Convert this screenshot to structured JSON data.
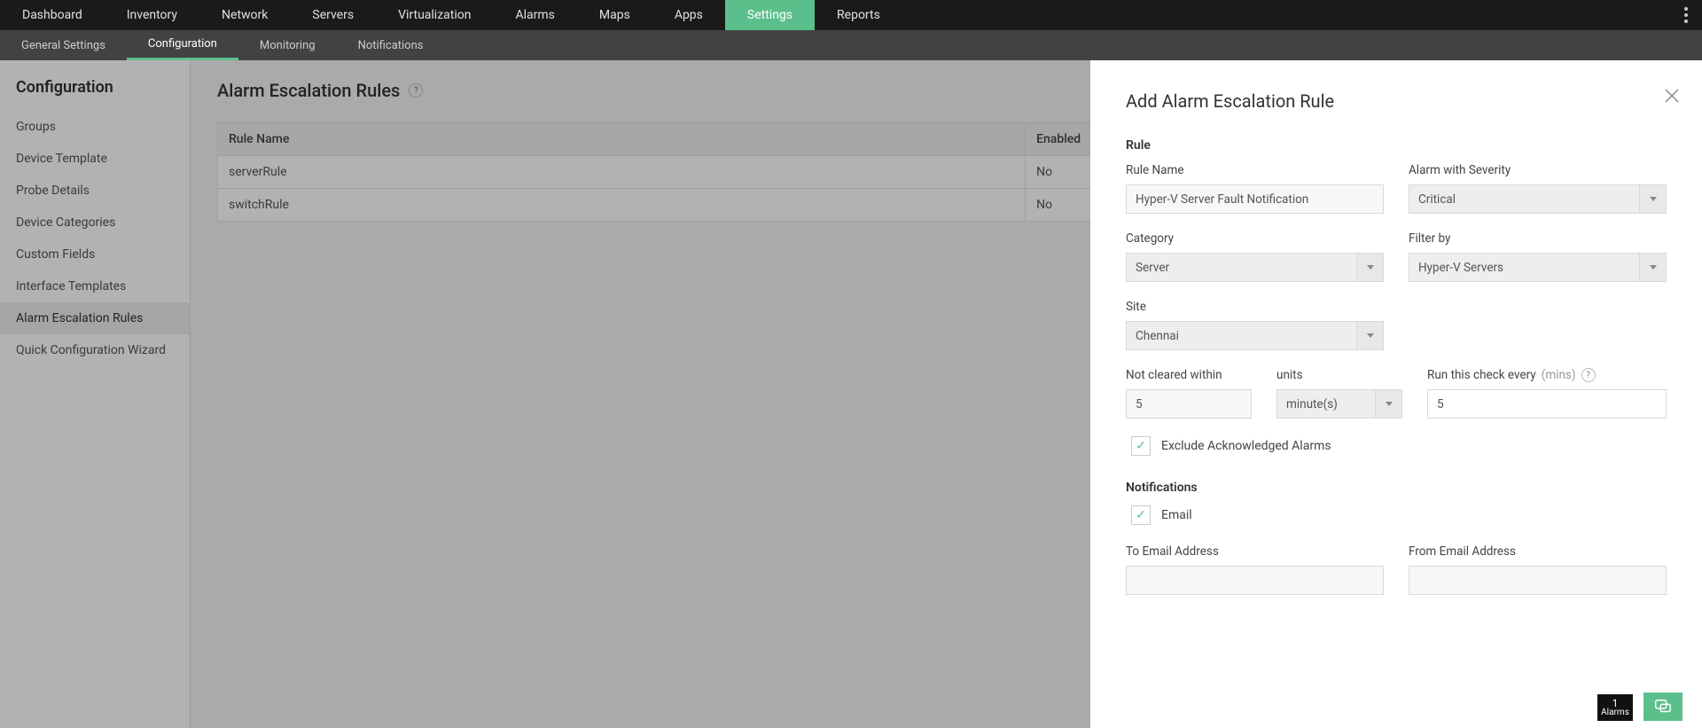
{
  "topnav": {
    "items": [
      "Dashboard",
      "Inventory",
      "Network",
      "Servers",
      "Virtualization",
      "Alarms",
      "Maps",
      "Apps",
      "Settings",
      "Reports"
    ],
    "active": "Settings"
  },
  "subnav": {
    "items": [
      "General Settings",
      "Configuration",
      "Monitoring",
      "Notifications"
    ],
    "active": "Configuration"
  },
  "sidebar": {
    "title": "Configuration",
    "items": [
      "Groups",
      "Device Template",
      "Probe Details",
      "Device Categories",
      "Custom Fields",
      "Interface Templates",
      "Alarm Escalation Rules",
      "Quick Configuration Wizard"
    ],
    "active": "Alarm Escalation Rules"
  },
  "page": {
    "title": "Alarm Escalation Rules",
    "help": "?",
    "columns": [
      "Rule Name",
      "Enabled"
    ],
    "rows": [
      {
        "name": "serverRule",
        "enabled": "No"
      },
      {
        "name": "switchRule",
        "enabled": "No"
      }
    ]
  },
  "panel": {
    "title": "Add Alarm Escalation Rule",
    "section_rule": "Rule",
    "rule_name_label": "Rule Name",
    "rule_name_value": "Hyper-V Server Fault Notification",
    "severity_label": "Alarm with Severity",
    "severity_value": "Critical",
    "category_label": "Category",
    "category_value": "Server",
    "filter_label": "Filter by",
    "filter_value": "Hyper-V Servers",
    "site_label": "Site",
    "site_value": "Chennai",
    "notcleared_label": "Not cleared within",
    "notcleared_value": "5",
    "units_label": "units",
    "units_value": "minute(s)",
    "runcheck_label": "Run this check every",
    "runcheck_hint": "(mins)",
    "runcheck_help": "?",
    "runcheck_value": "5",
    "exclude_label": "Exclude Acknowledged Alarms",
    "section_notifications": "Notifications",
    "email_label": "Email",
    "to_label": "To Email Address",
    "from_label": "From Email Address"
  },
  "floaters": {
    "alarm_count": "1",
    "alarm_text": "Alarms"
  }
}
